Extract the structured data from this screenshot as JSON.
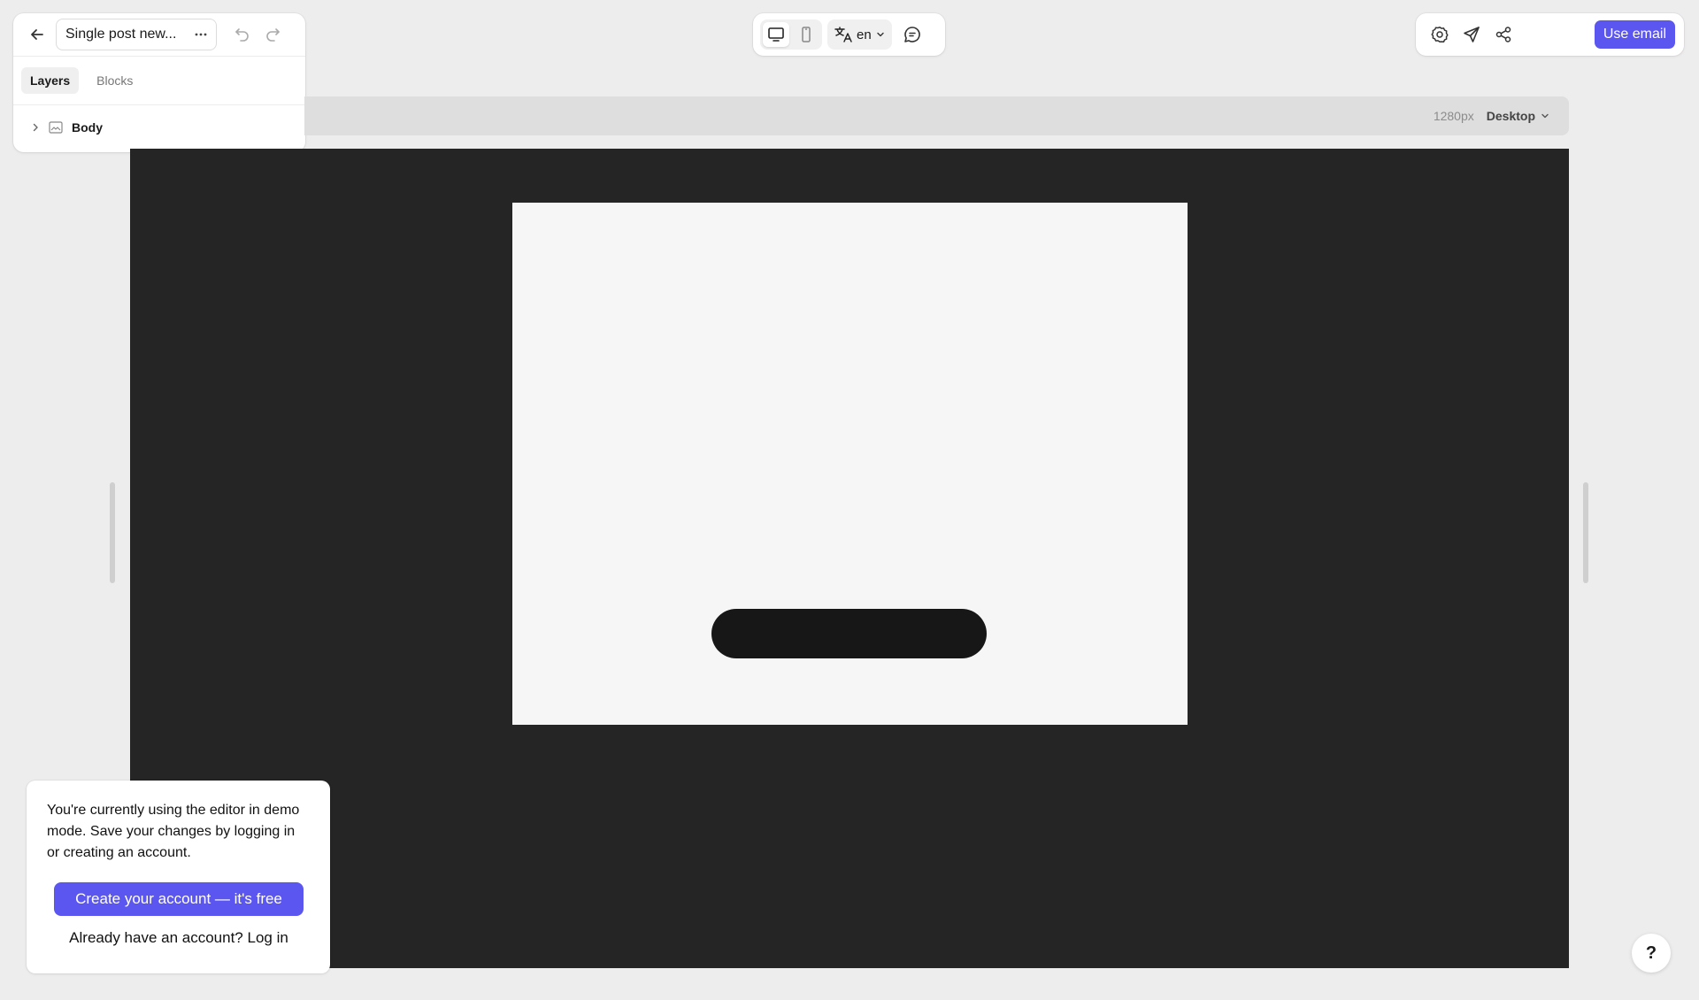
{
  "document": {
    "title": "Single post new..."
  },
  "left_panel": {
    "tabs": [
      {
        "label": "Layers",
        "active": true
      },
      {
        "label": "Blocks",
        "active": false
      }
    ],
    "layers": [
      {
        "label": "Body",
        "collapsed": true
      }
    ]
  },
  "toolbar": {
    "language": "en",
    "use_email_label": "Use email"
  },
  "viewport": {
    "width_label": "1280px",
    "device_label": "Desktop"
  },
  "demo_popup": {
    "message": "You're currently using the editor in demo mode. Save your changes by logging in or creating an account.",
    "create_account_label": "Create your account — it's free",
    "login_prompt": "Already have an account?",
    "login_link": "Log in"
  },
  "help": {
    "label": "?"
  },
  "colors": {
    "accent": "#5b56f0",
    "canvas_bg": "#252525",
    "card_bg": "#f6f6f6",
    "card_button": "#171717"
  }
}
